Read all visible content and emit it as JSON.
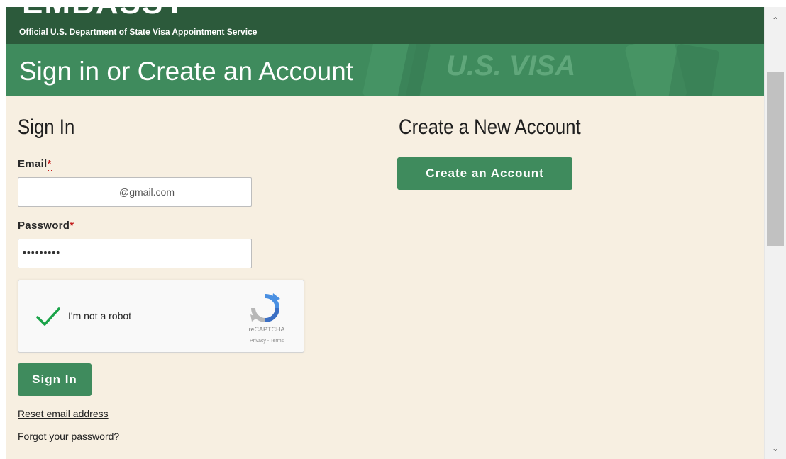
{
  "header": {
    "subtitle": "Official U.S. Department of State Visa Appointment Service",
    "banner_title": "Sign in or Create an Account",
    "banner_watermark": "U.S. VISA"
  },
  "sign_in": {
    "heading": "Sign In",
    "email_label": "Email",
    "email_value": "@gmail.com",
    "password_label": "Password",
    "password_value": "•••••••••",
    "required_mark": "*",
    "captcha": {
      "text": "I'm not a robot",
      "brand": "reCAPTCHA",
      "links": "Privacy - Terms"
    },
    "submit_label": "Sign In",
    "reset_email_link": "Reset email address",
    "forgot_password_link": "Forgot your password?"
  },
  "create_account": {
    "heading": "Create a New Account",
    "button_label": "Create an Account"
  },
  "colors": {
    "dark_green": "#2c5a3b",
    "green": "#3f8b5d",
    "page_bg": "#f7efe1"
  }
}
